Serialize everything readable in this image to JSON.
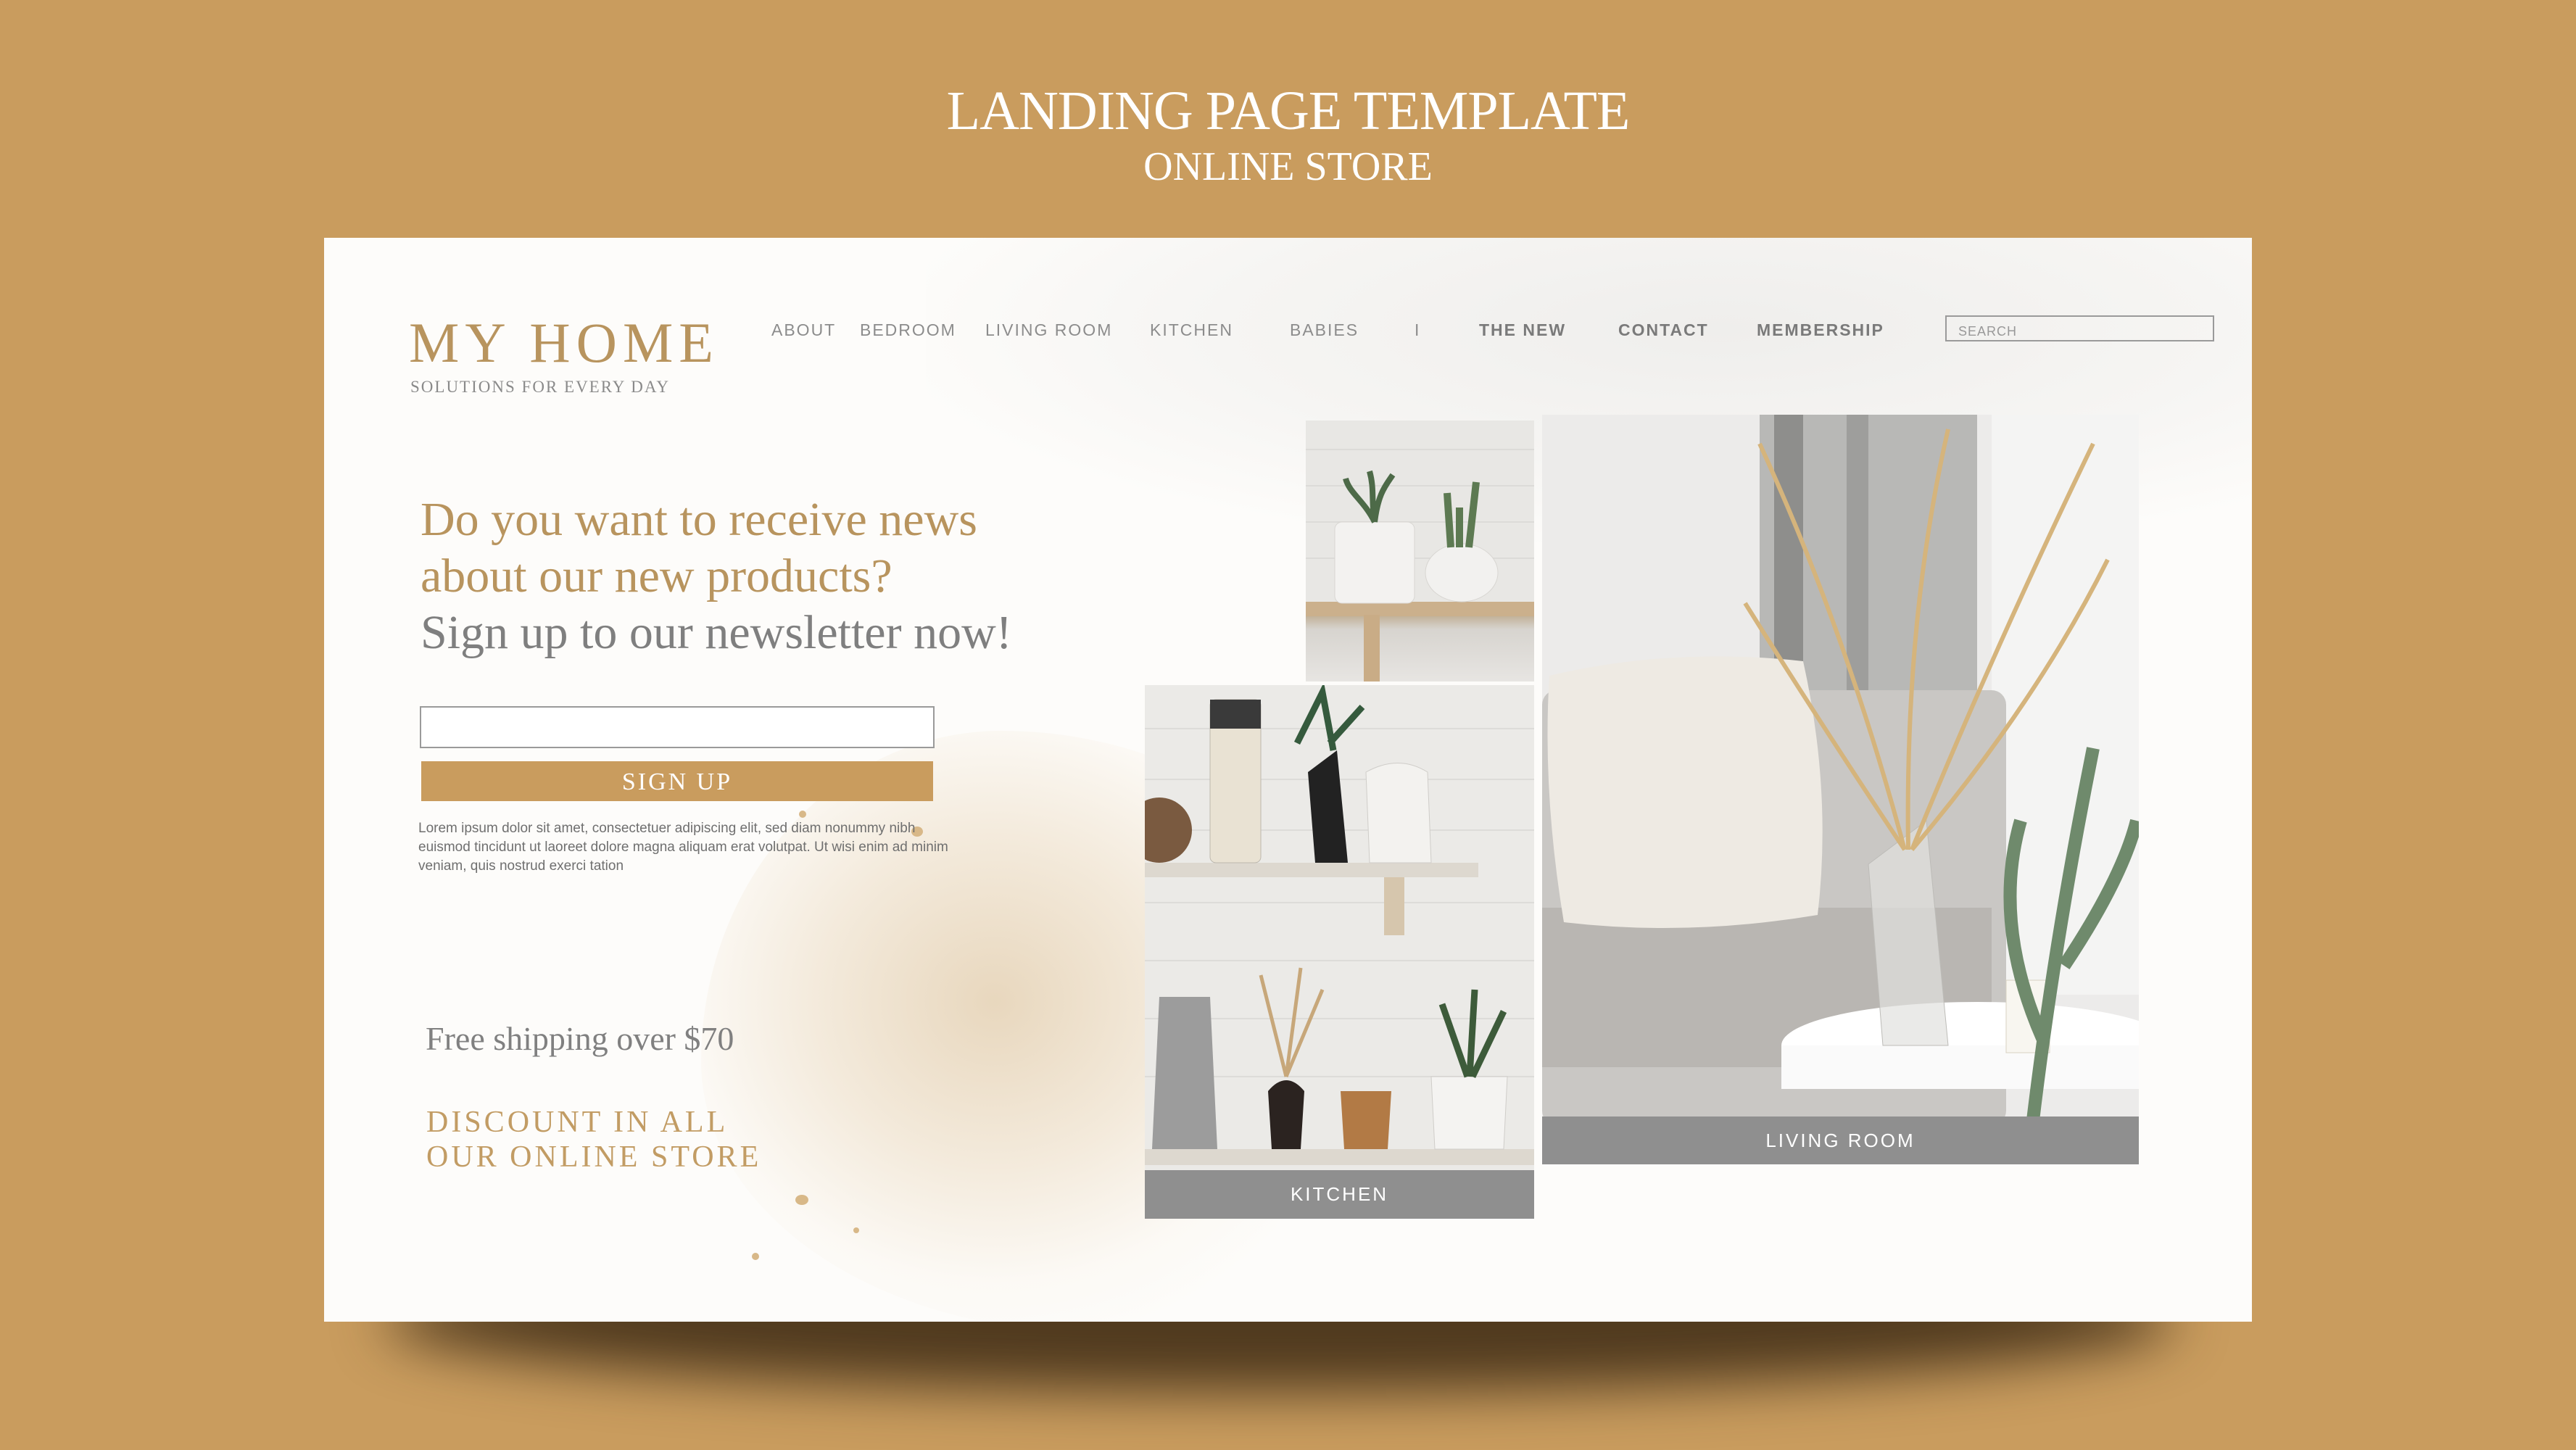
{
  "template": {
    "title": "LANDING PAGE TEMPLATE",
    "subtitle": "ONLINE STORE"
  },
  "header": {
    "logo": "MY HOME",
    "tagline": "SOLUTIONS FOR EVERY DAY",
    "nav": [
      {
        "label": "ABOUT"
      },
      {
        "label": "BEDROOM"
      },
      {
        "label": "LIVING ROOM"
      },
      {
        "label": "KITCHEN"
      },
      {
        "label": "BABIES"
      },
      {
        "label": "I"
      },
      {
        "label": "THE NEW"
      },
      {
        "label": "CONTACT"
      },
      {
        "label": "MEMBERSHIP"
      }
    ],
    "search_placeholder": "SEARCH"
  },
  "newsletter": {
    "line1": "Do you want to receive news",
    "line2": "about our new products?",
    "line3": "Sign up to our newsletter now!",
    "email_value": "",
    "signup_label": "SIGN UP",
    "lorem": "Lorem ipsum dolor sit amet, consectetuer adipiscing elit, sed diam nonummy nibh euismod tincidunt ut laoreet dolore magna aliquam erat volutpat. Ut wisi enim ad minim veniam, quis nostrud exerci tation"
  },
  "promo": {
    "shipping": "Free shipping over $70",
    "discount_line1": "DISCOUNT IN ALL",
    "discount_line2": "OUR ONLINE STORE"
  },
  "gallery": {
    "kitchen_caption": "KITCHEN",
    "living_caption": "LIVING ROOM"
  },
  "colors": {
    "background": "#c99c5e",
    "accent_gold": "#b8945e",
    "caption_grey": "#8f8f8f"
  }
}
